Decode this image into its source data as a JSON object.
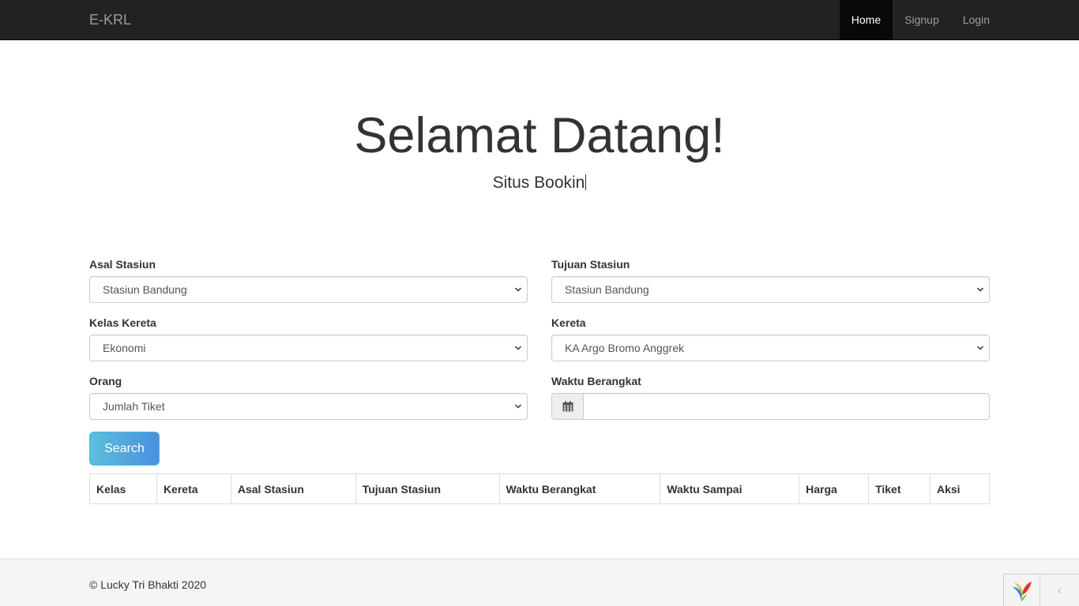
{
  "navbar": {
    "brand": "E-KRL",
    "links": [
      {
        "label": "Home",
        "active": true
      },
      {
        "label": "Signup",
        "active": false
      },
      {
        "label": "Login",
        "active": false
      }
    ]
  },
  "hero": {
    "title": "Selamat Datang!",
    "subtitle": "Situs Bookin"
  },
  "form": {
    "asal": {
      "label": "Asal Stasiun",
      "value": "Stasiun Bandung"
    },
    "tujuan": {
      "label": "Tujuan Stasiun",
      "value": "Stasiun Bandung"
    },
    "kelas": {
      "label": "Kelas Kereta",
      "value": "Ekonomi"
    },
    "kereta": {
      "label": "Kereta",
      "value": "KA Argo Bromo Anggrek"
    },
    "orang": {
      "label": "Orang",
      "value": "Jumlah Tiket"
    },
    "waktu": {
      "label": "Waktu Berangkat",
      "value": "",
      "icon": "calendar-icon"
    },
    "search_label": "Search"
  },
  "table": {
    "headers": [
      "Kelas",
      "Kereta",
      "Asal Stasiun",
      "Tujuan Stasiun",
      "Waktu Berangkat",
      "Waktu Sampai",
      "Harga",
      "Tiket",
      "Aksi"
    ],
    "rows": []
  },
  "footer": {
    "copyright": "© Lucky Tri Bhakti 2020"
  },
  "debug_toolbar": {
    "logo_icon": "yii-logo-icon",
    "toggle_icon": "chevron-left-icon"
  },
  "colors": {
    "navbar_bg": "#222222",
    "search_button": "#5bc0de"
  }
}
